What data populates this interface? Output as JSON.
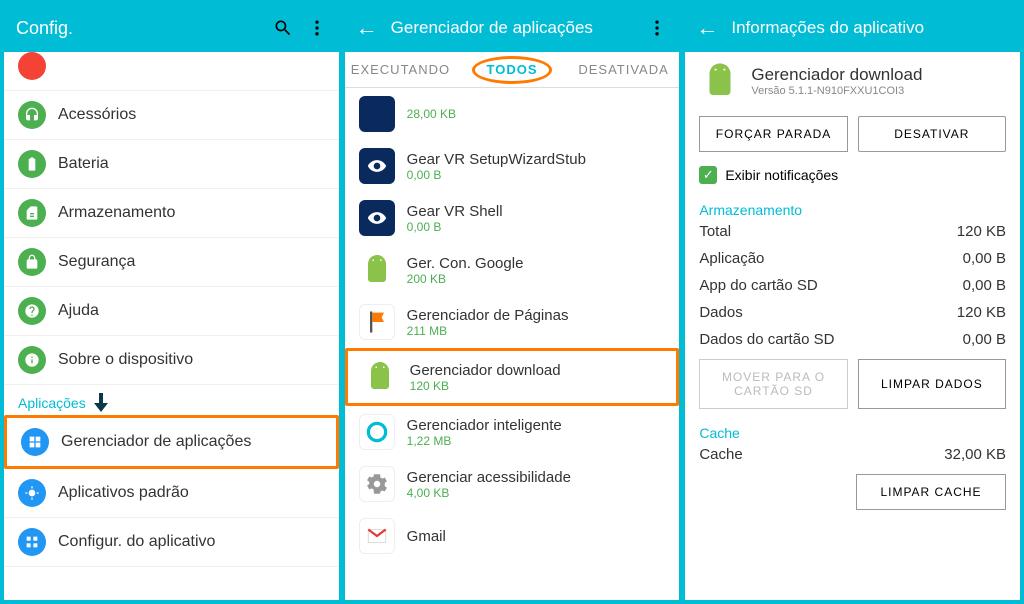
{
  "panel1": {
    "title": "Config.",
    "items": [
      {
        "label": "Acessórios",
        "icon": "headset-icon",
        "color": "#4caf50"
      },
      {
        "label": "Bateria",
        "icon": "battery-icon",
        "color": "#4caf50"
      },
      {
        "label": "Armazenamento",
        "icon": "storage-icon",
        "color": "#4caf50"
      },
      {
        "label": "Segurança",
        "icon": "lock-icon",
        "color": "#4caf50"
      },
      {
        "label": "Ajuda",
        "icon": "help-icon",
        "color": "#4caf50"
      },
      {
        "label": "Sobre o dispositivo",
        "icon": "info-icon",
        "color": "#4caf50"
      }
    ],
    "section_label": "Aplicações",
    "app_items": [
      {
        "label": "Gerenciador de aplicações",
        "icon": "apps-icon",
        "highlighted": true
      },
      {
        "label": "Aplicativos padrão",
        "icon": "default-apps-icon"
      },
      {
        "label": "Configur. do aplicativo",
        "icon": "app-config-icon"
      }
    ]
  },
  "panel2": {
    "title": "Gerenciador de aplicações",
    "tabs": {
      "executando": "EXECUTANDO",
      "todos": "TODOS",
      "desativados": "DESATIVADA"
    },
    "apps": [
      {
        "name": "",
        "size": "28,00 KB",
        "icon_bg": "#0a2a5e",
        "icon": "gear-small-icon"
      },
      {
        "name": "Gear VR SetupWizardStub",
        "size": "0,00 B",
        "icon_bg": "#0a2a5e",
        "icon": "eye-icon"
      },
      {
        "name": "Gear VR Shell",
        "size": "0,00 B",
        "icon_bg": "#0a2a5e",
        "icon": "eye-icon"
      },
      {
        "name": "Ger. Con. Google",
        "size": "200 KB",
        "icon_bg": "transparent",
        "icon": "android-icon"
      },
      {
        "name": "Gerenciador de Páginas",
        "size": "211 MB",
        "icon_bg": "#fff",
        "icon": "flag-icon"
      },
      {
        "name": "Gerenciador download",
        "size": "120 KB",
        "icon_bg": "transparent",
        "icon": "android-icon",
        "highlighted": true
      },
      {
        "name": "Gerenciador inteligente",
        "size": "1,22 MB",
        "icon_bg": "#fff",
        "icon": "ring-icon"
      },
      {
        "name": "Gerenciar acessibilidade",
        "size": "4,00 KB",
        "icon_bg": "#fff",
        "icon": "gear-icon"
      },
      {
        "name": "Gmail",
        "size": "",
        "icon_bg": "#fff",
        "icon": "gmail-icon"
      }
    ]
  },
  "panel3": {
    "title": "Informações do aplicativo",
    "app_name": "Gerenciador download",
    "version": "Versão 5.1.1-N910FXXU1COI3",
    "force_stop": "FORÇAR PARADA",
    "disable": "DESATIVAR",
    "show_notifications": "Exibir notificações",
    "storage_label": "Armazenamento",
    "storage": {
      "total_label": "Total",
      "total_value": "120 KB",
      "app_label": "Aplicação",
      "app_value": "0,00 B",
      "sd_app_label": "App do cartão SD",
      "sd_app_value": "0,00 B",
      "data_label": "Dados",
      "data_value": "120 KB",
      "sd_data_label": "Dados do cartão SD",
      "sd_data_value": "0,00 B"
    },
    "move_sd": "MOVER PARA O CARTÃO SD",
    "clear_data": "LIMPAR DADOS",
    "cache_label": "Cache",
    "cache_row_label": "Cache",
    "cache_value": "32,00 KB",
    "clear_cache": "LIMPAR CACHE"
  }
}
